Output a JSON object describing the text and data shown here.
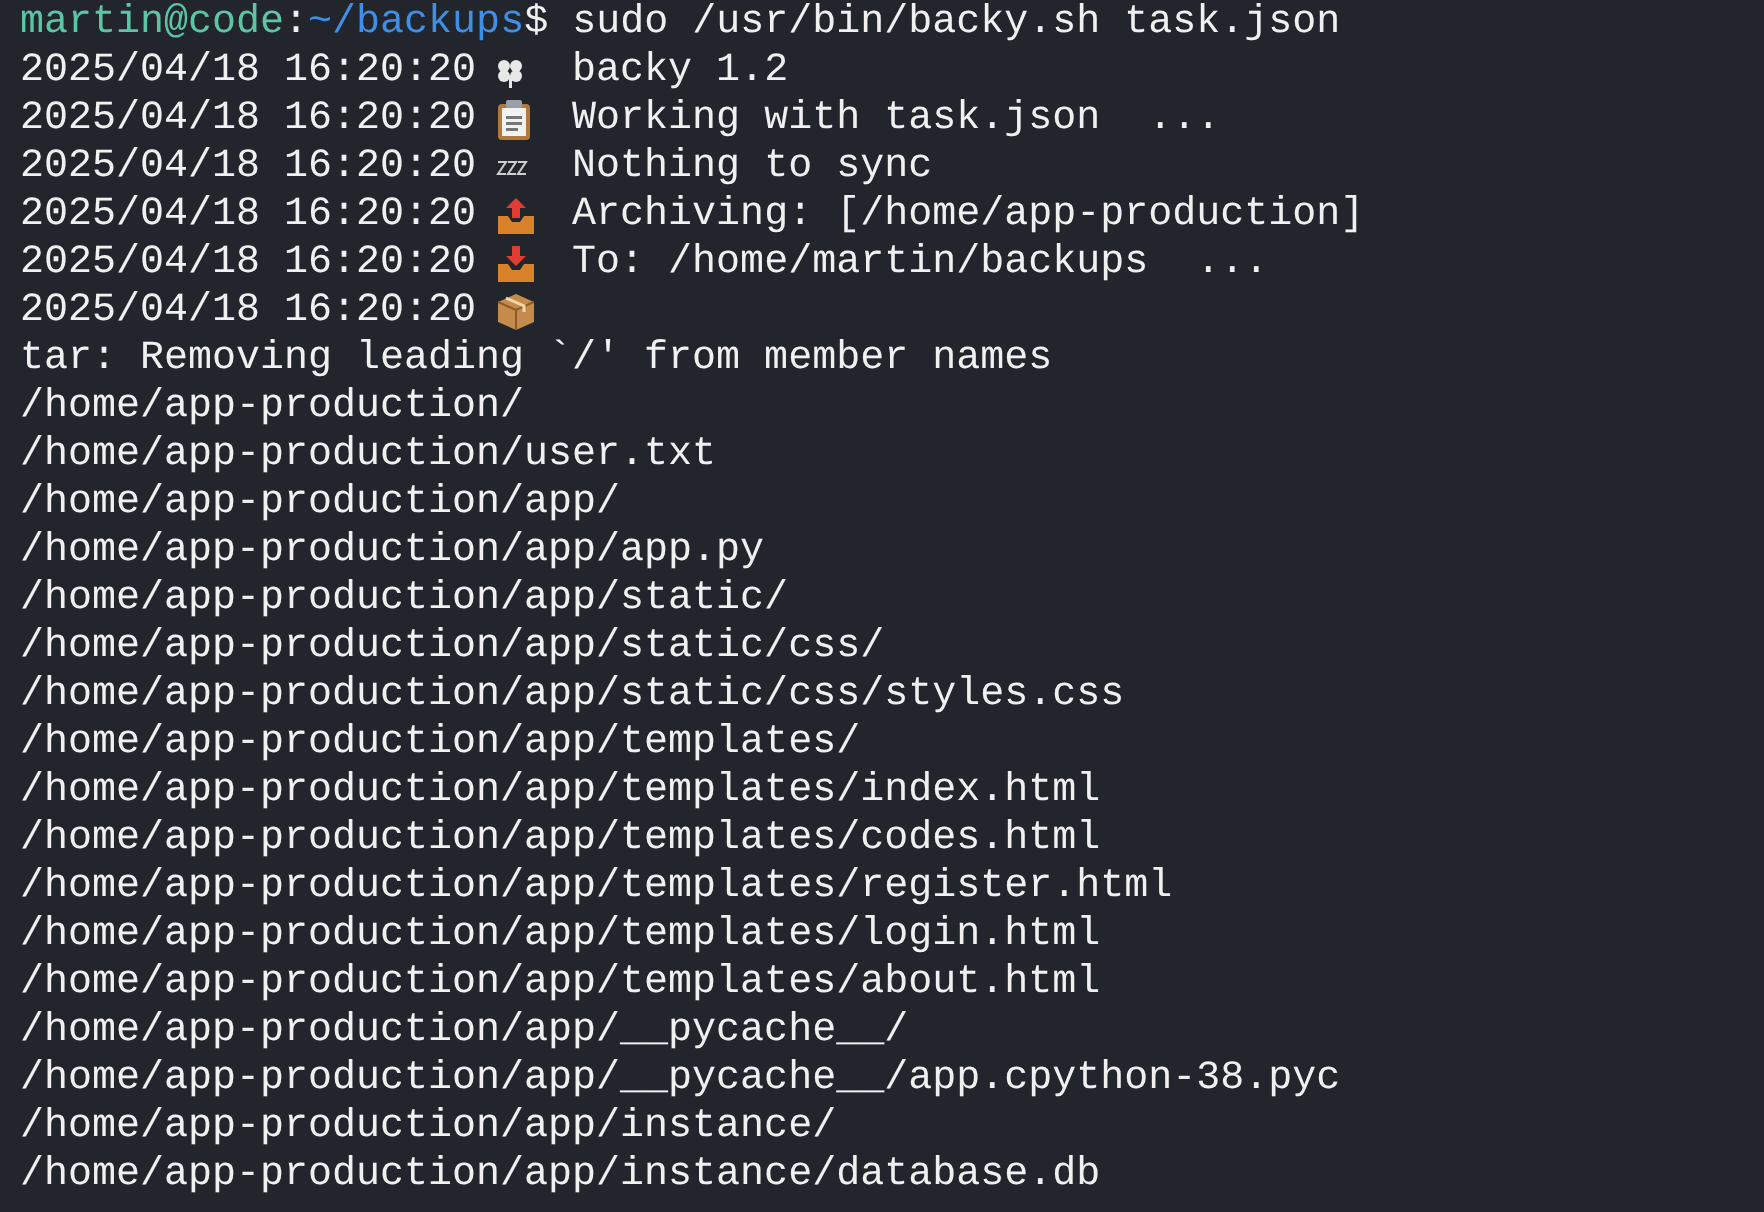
{
  "prompt": {
    "user_host": "martin@code",
    "separator": ":",
    "path": "~/backups",
    "symbol": "$",
    "command": "sudo /usr/bin/backy.sh task.json"
  },
  "log_lines": [
    {
      "timestamp": "2025/04/18 16:20:20",
      "kind": "clover",
      "message": "backy 1.2"
    },
    {
      "timestamp": "2025/04/18 16:20:20",
      "kind": "clipboard",
      "message": "Working with task.json  ..."
    },
    {
      "timestamp": "2025/04/18 16:20:20",
      "kind": "zzz",
      "message": "Nothing to sync"
    },
    {
      "timestamp": "2025/04/18 16:20:20",
      "kind": "outbox",
      "message": "Archiving: [/home/app-production]"
    },
    {
      "timestamp": "2025/04/18 16:20:20",
      "kind": "inbox",
      "message": "To: /home/martin/backups  ..."
    },
    {
      "timestamp": "2025/04/18 16:20:20",
      "kind": "package"
    }
  ],
  "output_lines": [
    "tar: Removing leading `/' from member names",
    "/home/app-production/",
    "/home/app-production/user.txt",
    "/home/app-production/app/",
    "/home/app-production/app/app.py",
    "/home/app-production/app/static/",
    "/home/app-production/app/static/css/",
    "/home/app-production/app/static/css/styles.css",
    "/home/app-production/app/templates/",
    "/home/app-production/app/templates/index.html",
    "/home/app-production/app/templates/codes.html",
    "/home/app-production/app/templates/register.html",
    "/home/app-production/app/templates/login.html",
    "/home/app-production/app/templates/about.html",
    "/home/app-production/app/__pycache__/",
    "/home/app-production/app/__pycache__/app.cpython-38.pyc",
    "/home/app-production/app/instance/",
    "/home/app-production/app/instance/database.db"
  ]
}
